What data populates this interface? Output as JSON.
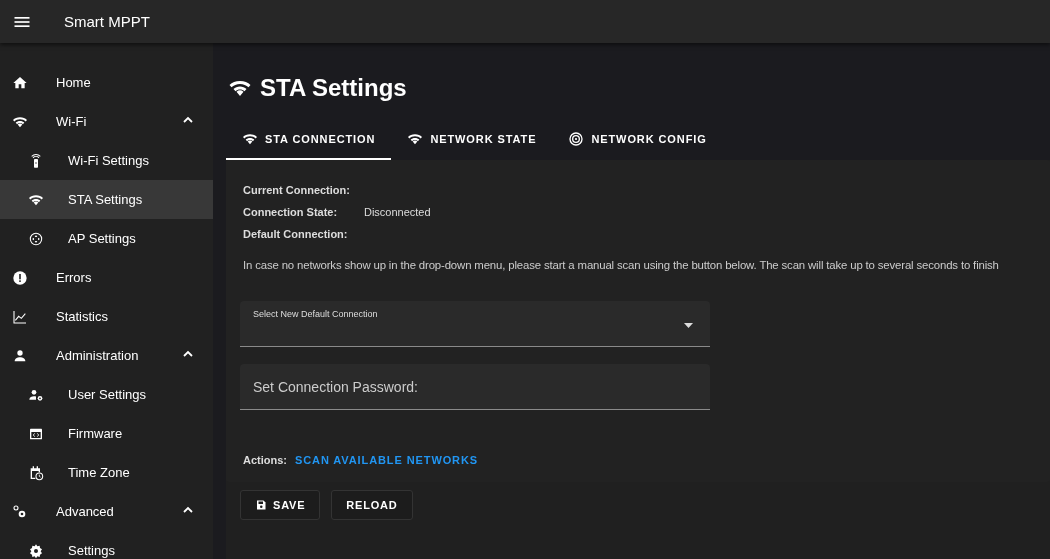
{
  "app_bar": {
    "title": "Smart MPPT"
  },
  "sidebar": {
    "items": [
      {
        "label": "Home",
        "selected": false
      },
      {
        "label": "Wi-Fi",
        "expanded": true,
        "children": [
          {
            "label": "Wi-Fi Settings",
            "selected": false
          },
          {
            "label": "STA Settings",
            "selected": true
          },
          {
            "label": "AP Settings",
            "selected": false
          }
        ]
      },
      {
        "label": "Errors",
        "selected": false
      },
      {
        "label": "Statistics",
        "selected": false
      },
      {
        "label": "Administration",
        "expanded": true,
        "children": [
          {
            "label": "User Settings",
            "selected": false
          },
          {
            "label": "Firmware",
            "selected": false
          },
          {
            "label": "Time Zone",
            "selected": false
          }
        ]
      },
      {
        "label": "Advanced",
        "expanded": true,
        "children": [
          {
            "label": "Settings",
            "selected": false
          }
        ]
      }
    ]
  },
  "page": {
    "title": "STA Settings",
    "tabs": [
      {
        "label": "STA CONNECTION",
        "selected": true
      },
      {
        "label": "NETWORK STATE",
        "selected": false
      },
      {
        "label": "NETWORK CONFIG",
        "selected": false
      }
    ],
    "info": [
      {
        "label": "Current Connection:"
      },
      {
        "label": "Connection State:",
        "value": "Disconnected"
      },
      {
        "label": "Default Connection:"
      }
    ],
    "note": "In case no networks show up in the drop-down menu, please start a manual scan using the button below. The scan will take up to several seconds to finish",
    "select": {
      "label": "Select New Default Connection"
    },
    "password": {
      "placeholder": "Set Connection Password:"
    },
    "actions": {
      "label": "Actions:",
      "link": "SCAN AVAILABLE NETWORKS"
    },
    "buttons": [
      "SAVE",
      "RELOAD"
    ]
  }
}
